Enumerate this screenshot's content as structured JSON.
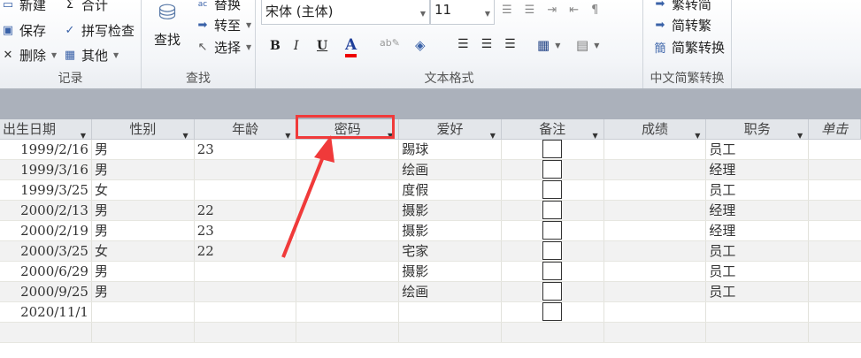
{
  "ribbon": {
    "records": {
      "label": "记录",
      "new": "新建",
      "save": "保存",
      "delete": "删除",
      "sum": "合计",
      "spell": "拼写检查",
      "other": "其他"
    },
    "find": {
      "label": "查找",
      "find": "查找",
      "replace": "替换",
      "goto": "转至",
      "select": "选择"
    },
    "text_format": {
      "label": "文本格式",
      "font": "宋体 (主体)",
      "size": "11",
      "bold": "B",
      "italic": "I",
      "underline": "U",
      "font_color": "A"
    },
    "chinese": {
      "label": "中文简繁转换",
      "t2s": "繁转简",
      "s2t": "简转繁",
      "convert": "简繁转换"
    }
  },
  "table": {
    "columns": [
      "出生日期",
      "性别",
      "年龄",
      "密码",
      "爱好",
      "备注",
      "成绩",
      "职务",
      "单击"
    ],
    "rows": [
      {
        "date": "1999/2/16",
        "gender": "男",
        "age": "23",
        "pwd": "",
        "hobby": "踢球",
        "note": false,
        "score": "",
        "role": "员工"
      },
      {
        "date": "1999/3/16",
        "gender": "男",
        "age": "",
        "pwd": "",
        "hobby": "绘画",
        "note": false,
        "score": "",
        "role": "经理"
      },
      {
        "date": "1999/3/25",
        "gender": "女",
        "age": "",
        "pwd": "",
        "hobby": "度假",
        "note": false,
        "score": "",
        "role": "员工"
      },
      {
        "date": "2000/2/13",
        "gender": "男",
        "age": "22",
        "pwd": "",
        "hobby": "摄影",
        "note": false,
        "score": "",
        "role": "经理"
      },
      {
        "date": "2000/2/19",
        "gender": "男",
        "age": "23",
        "pwd": "",
        "hobby": "摄影",
        "note": false,
        "score": "",
        "role": "经理"
      },
      {
        "date": "2000/3/25",
        "gender": "女",
        "age": "22",
        "pwd": "",
        "hobby": "宅家",
        "note": false,
        "score": "",
        "role": "员工"
      },
      {
        "date": "2000/6/29",
        "gender": "男",
        "age": "",
        "pwd": "",
        "hobby": "摄影",
        "note": false,
        "score": "",
        "role": "员工"
      },
      {
        "date": "2000/9/25",
        "gender": "男",
        "age": "",
        "pwd": "",
        "hobby": "绘画",
        "note": false,
        "score": "",
        "role": "员工"
      },
      {
        "date": "2020/11/1",
        "gender": "",
        "age": "",
        "pwd": "",
        "hobby": "",
        "note": false,
        "score": "",
        "role": ""
      }
    ]
  },
  "colors": {
    "annotation": "#f03a3a",
    "band": "#abb1bb"
  }
}
